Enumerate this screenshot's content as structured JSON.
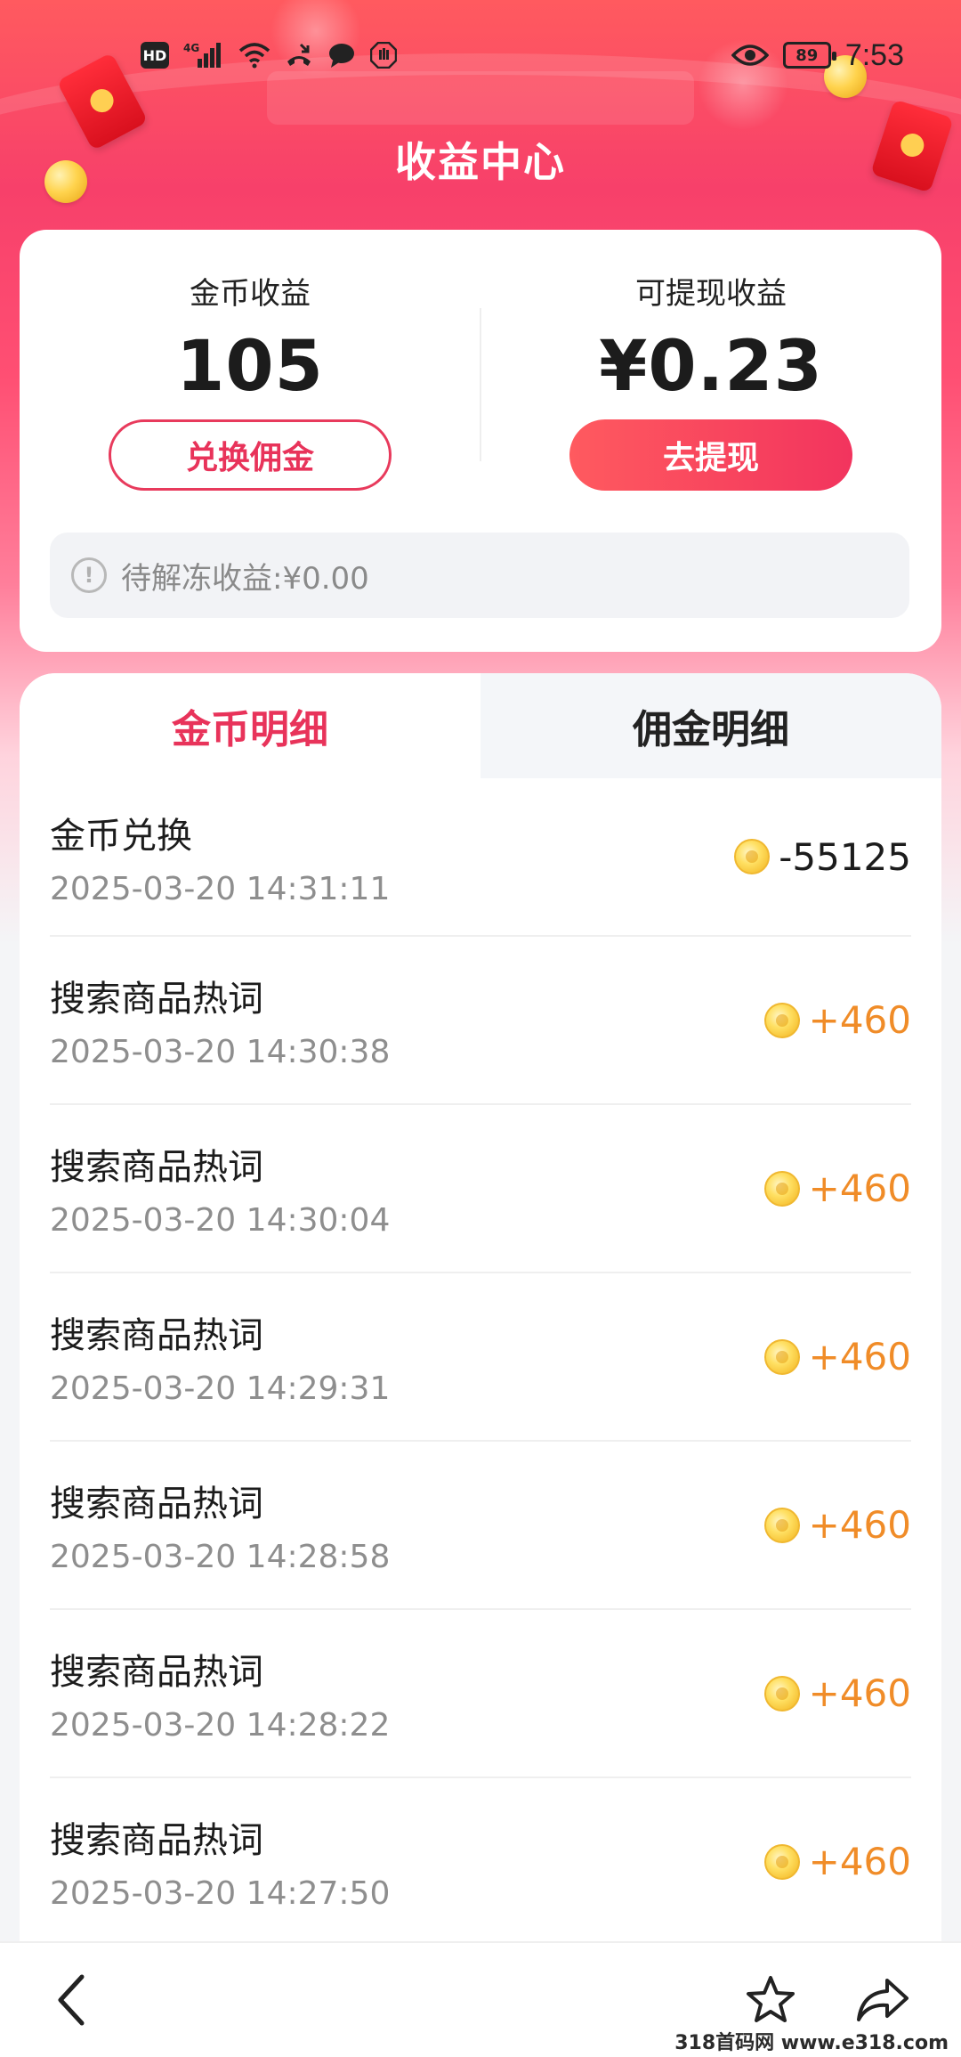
{
  "status_bar": {
    "hd_label": "HD",
    "network_label": "4G",
    "battery_level": "89",
    "time": "7:53"
  },
  "page": {
    "title": "收益中心"
  },
  "earnings": {
    "coins_label": "金币收益",
    "coins_value": "105",
    "exchange_button": "兑换佣金",
    "withdrawable_label": "可提现收益",
    "withdrawable_value": "¥0.23",
    "withdraw_button": "去提现",
    "frozen_text": "待解冻收益:¥0.00"
  },
  "tabs": [
    {
      "label": "金币明细",
      "active": true
    },
    {
      "label": "佣金明细",
      "active": false
    }
  ],
  "records": [
    {
      "title": "金币兑换",
      "time": "2025-03-20 14:31:11",
      "amount": "-55125",
      "sign": "neg"
    },
    {
      "title": "搜索商品热词",
      "time": "2025-03-20 14:30:38",
      "amount": "+460",
      "sign": "pos"
    },
    {
      "title": "搜索商品热词",
      "time": "2025-03-20 14:30:04",
      "amount": "+460",
      "sign": "pos"
    },
    {
      "title": "搜索商品热词",
      "time": "2025-03-20 14:29:31",
      "amount": "+460",
      "sign": "pos"
    },
    {
      "title": "搜索商品热词",
      "time": "2025-03-20 14:28:58",
      "amount": "+460",
      "sign": "pos"
    },
    {
      "title": "搜索商品热词",
      "time": "2025-03-20 14:28:22",
      "amount": "+460",
      "sign": "pos"
    },
    {
      "title": "搜索商品热词",
      "time": "2025-03-20 14:27:50",
      "amount": "+460",
      "sign": "pos"
    }
  ],
  "icons": {
    "back": "chevron-left-icon",
    "favorite": "star-icon",
    "share": "share-icon"
  },
  "colors": {
    "accent": "#e8335a",
    "positive_amount": "#f08c28",
    "header_gradient_start": "#ff5a5f"
  },
  "watermark": "318首码网 www.e318.com"
}
